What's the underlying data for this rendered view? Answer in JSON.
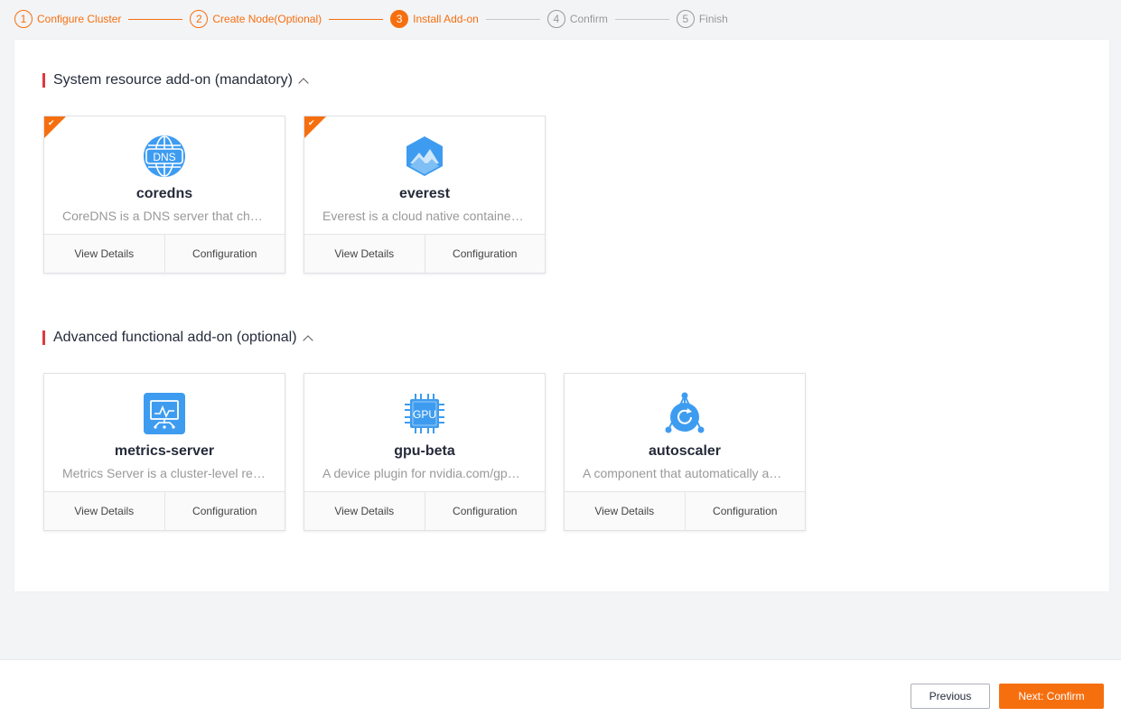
{
  "stepper": {
    "steps": [
      {
        "num": "1",
        "label": "Configure Cluster"
      },
      {
        "num": "2",
        "label": "Create Node(Optional)"
      },
      {
        "num": "3",
        "label": "Install Add-on"
      },
      {
        "num": "4",
        "label": "Confirm"
      },
      {
        "num": "5",
        "label": "Finish"
      }
    ]
  },
  "sections": [
    {
      "title": "System resource add-on (mandatory)",
      "cards": [
        {
          "name": "coredns",
          "desc": "CoreDNS is a DNS server that chains plugins",
          "icon": "dns-globe-icon",
          "selected": true,
          "view_label": "View Details",
          "config_label": "Configuration"
        },
        {
          "name": "everest",
          "desc": "Everest is a cloud native container storage",
          "icon": "mountain-hexagon-icon",
          "selected": true,
          "view_label": "View Details",
          "config_label": "Configuration"
        }
      ]
    },
    {
      "title": "Advanced functional add-on (optional)",
      "cards": [
        {
          "name": "metrics-server",
          "desc": "Metrics Server is a cluster-level resource usage",
          "icon": "monitor-chart-icon",
          "selected": false,
          "view_label": "View Details",
          "config_label": "Configuration"
        },
        {
          "name": "gpu-beta",
          "desc": "A device plugin for nvidia.com/gpu resource",
          "icon": "gpu-chip-icon",
          "selected": false,
          "view_label": "View Details",
          "config_label": "Configuration"
        },
        {
          "name": "autoscaler",
          "desc": "A component that automatically adjusts the size",
          "icon": "autoscaler-icon",
          "selected": false,
          "view_label": "View Details",
          "config_label": "Configuration"
        }
      ]
    }
  ],
  "footer": {
    "previous_label": "Previous",
    "next_label": "Next: Confirm"
  },
  "colors": {
    "accent": "#f66f0f",
    "section_marker": "#e0383e",
    "icon_blue": "#3e9cf0"
  }
}
